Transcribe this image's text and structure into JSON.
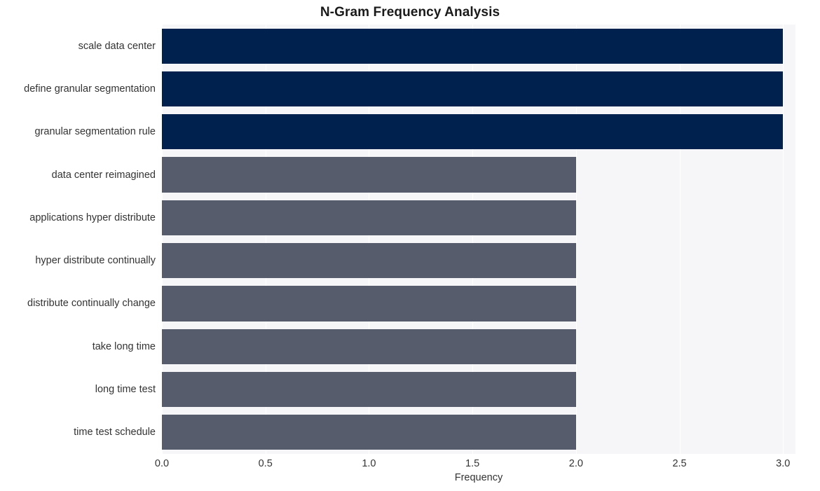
{
  "chart_data": {
    "type": "bar",
    "orientation": "horizontal",
    "title": "N-Gram Frequency Analysis",
    "xlabel": "Frequency",
    "ylabel": "",
    "xlim": [
      0,
      3.06
    ],
    "xticks": [
      "0.0",
      "0.5",
      "1.0",
      "1.5",
      "2.0",
      "2.5",
      "3.0"
    ],
    "xtick_values": [
      0.0,
      0.5,
      1.0,
      1.5,
      2.0,
      2.5,
      3.0
    ],
    "grid": true,
    "legend": "none",
    "categories": [
      "scale data center",
      "define granular segmentation",
      "granular segmentation rule",
      "data center reimagined",
      "applications hyper distribute",
      "hyper distribute continually",
      "distribute continually change",
      "take long time",
      "long time test",
      "time test schedule"
    ],
    "values": [
      3,
      3,
      3,
      2,
      2,
      2,
      2,
      2,
      2,
      2
    ],
    "bar_colors": [
      "#00214e",
      "#00214e",
      "#00214e",
      "#565c6c",
      "#565c6c",
      "#565c6c",
      "#565c6c",
      "#565c6c",
      "#565c6c",
      "#565c6c"
    ]
  },
  "style": {
    "figure_background": "#ffffff",
    "plot_background": "#f6f6f8",
    "gridline_color": "#ffffff",
    "title_color": "#1a1a1a",
    "tick_label_color": "#333333",
    "accent_high": "#00214e",
    "accent_low": "#565c6c"
  }
}
